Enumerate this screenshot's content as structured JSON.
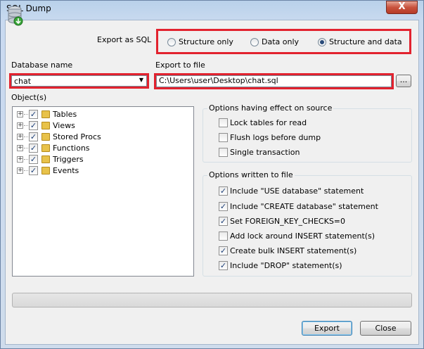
{
  "window": {
    "title": "SQL Dump",
    "close_symbol": "X"
  },
  "export_as": {
    "label": "Export as SQL",
    "options": [
      {
        "label": "Structure only",
        "selected": false
      },
      {
        "label": "Data only",
        "selected": false
      },
      {
        "label": "Structure and data",
        "selected": true
      }
    ]
  },
  "database": {
    "label": "Database name",
    "value": "chat"
  },
  "export_file": {
    "label": "Export to file",
    "value": "C:\\Users\\user\\Desktop\\chat.sql",
    "browse_label": "..."
  },
  "objects": {
    "label": "Object(s)",
    "items": [
      {
        "label": "Tables",
        "checked": true
      },
      {
        "label": "Views",
        "checked": true
      },
      {
        "label": "Stored Procs",
        "checked": true
      },
      {
        "label": "Functions",
        "checked": true
      },
      {
        "label": "Triggers",
        "checked": true
      },
      {
        "label": "Events",
        "checked": true
      }
    ]
  },
  "source_options": {
    "title": "Options having effect on source",
    "items": [
      {
        "label": "Lock tables for read",
        "checked": false
      },
      {
        "label": "Flush logs before dump",
        "checked": false
      },
      {
        "label": "Single transaction",
        "checked": false
      }
    ]
  },
  "file_options": {
    "title": "Options written to file",
    "items": [
      {
        "label": "Include \"USE database\" statement",
        "checked": true
      },
      {
        "label": "Include \"CREATE database\" statement",
        "checked": true
      },
      {
        "label": "Set FOREIGN_KEY_CHECKS=0",
        "checked": true
      },
      {
        "label": "Add lock around INSERT statement(s)",
        "checked": false
      },
      {
        "label": "Create bulk INSERT statement(s)",
        "checked": true
      },
      {
        "label": "Include \"DROP\" statement(s)",
        "checked": true
      }
    ]
  },
  "progress": {
    "value": 0
  },
  "buttons": {
    "export": "Export",
    "close": "Close"
  },
  "colors": {
    "highlight_border": "#e2222e",
    "check_mark": "#1c3f78"
  }
}
